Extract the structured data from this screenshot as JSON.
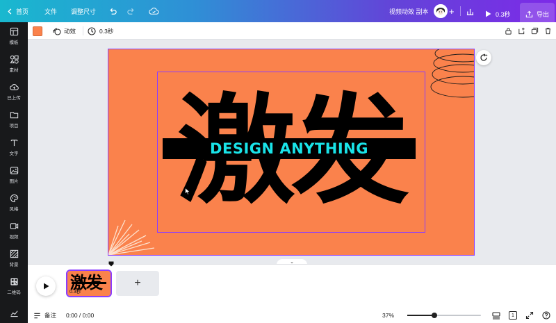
{
  "topbar": {
    "home_label": "首页",
    "file_label": "文件",
    "resize_label": "调整尺寸",
    "design_title": "视频动效 副本",
    "play_duration": "0.3秒",
    "export_label": "导出"
  },
  "sidebar": {
    "items": [
      {
        "label": "模板",
        "icon": "template-icon"
      },
      {
        "label": "素材",
        "icon": "elements-icon"
      },
      {
        "label": "已上传",
        "icon": "upload-icon"
      },
      {
        "label": "项目",
        "icon": "folder-icon"
      },
      {
        "label": "文字",
        "icon": "text-icon"
      },
      {
        "label": "图片",
        "icon": "image-icon"
      },
      {
        "label": "风格",
        "icon": "style-icon"
      },
      {
        "label": "视频",
        "icon": "video-icon"
      },
      {
        "label": "背景",
        "icon": "background-icon"
      },
      {
        "label": "二维码",
        "icon": "qr-icon"
      },
      {
        "label": "",
        "icon": "chart-icon"
      }
    ]
  },
  "context_toolbar": {
    "swatch_color": "#fa824c",
    "animate_label": "动效",
    "duration_label": "0.3秒"
  },
  "canvas": {
    "background_color": "#fa824c",
    "headline": "激发",
    "banner_text": "DESIGN ANYTHING",
    "banner_text_color": "#19e3e8",
    "selection_color": "#8b3dff"
  },
  "timeline": {
    "thumbnail_text": "激发",
    "thumbnail_duration": "0.3秒",
    "add_page_label": "+"
  },
  "bottombar": {
    "notes_label": "备注",
    "time_readout": "0:00 / 0:00",
    "zoom_level": "37%",
    "zoom_fraction": 0.37,
    "page_number": "1"
  }
}
